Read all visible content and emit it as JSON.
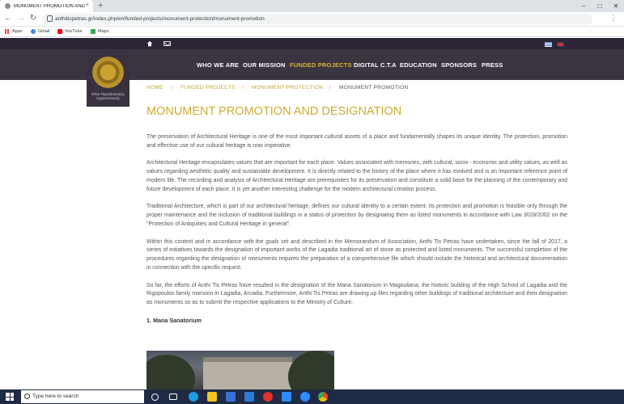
{
  "browser": {
    "tab_title": "MONUMENT PROMOTION AND",
    "tab_close": "×",
    "new_tab": "+",
    "url": "anthitispetras.gr/index.php/en/funded-projects/monument-protection/monument-promotion",
    "bookmarks": [
      "Apps",
      "Gmail",
      "YouTube",
      "Maps"
    ]
  },
  "site": {
    "logo_text": "Φίλοι Παραδοσιακής Αρχιτεκτονικής",
    "nav": [
      {
        "label": "WHO WE ARE"
      },
      {
        "label": "OUR MISSION"
      },
      {
        "label": "FUNDED PROJECTS"
      },
      {
        "label": "DIGITAL C.T.A"
      },
      {
        "label": "EDUCATION"
      },
      {
        "label": "SPONSORS"
      },
      {
        "label": "PRESS"
      }
    ],
    "breadcrumb": [
      "HOME",
      "FUNDED PROJECTS",
      "MONUMENT PROTECTION",
      "MONUMENT PROMOTION"
    ],
    "breadcrumb_sep": "/",
    "page_title": "MONUMENT PROMOTION AND DESIGNATION",
    "paragraphs": [
      "The preservation of Architectural Heritage is one of the most important cultural assets of a place and fundamentally shapes its unique identity. The protection, promotion and effective use of our cultural heritage is now imperative.",
      " Architectural Heritage encapsulates values that are important for each place. Values associated with memories, with cultural, socio - economic and utility values, as well as values regarding aesthetic quality and sustainable development. It is directly related to the history of the place where it has evolved and is an important reference point of modern life. The recording and analysis of Architectural Heritage are prerequisites for its preservation and constitute a solid base for the planning of the contemporary and future development of each place. It is yet another interesting challenge for the modern architectural creation process.",
      " Traditional Architecture, which is part of our architectural heritage, defines our cultural identity to a certain extent. Its protection and promotion is feasible only through the proper maintenance and the inclusion of traditional buildings in a status of protection by designating them as listed monuments in accordance with Law 3028/2002 on the \"Protection of Antiquities and Cultural Heritage in general\".",
      "Within this context and in accordance with the goals set and described in the Memorandum of Association, Anthi Tis Petras have undertaken, since the fall of 2017, a series of initiatives towards the designation of important works of the Lagadia traditional art of stone as protected and listed monuments. The successful completion of the procedures regarding the designation of monuments requires the preparation of a comprehensive file which should include the historical and architectural documentation in connection with the specific request.",
      " So far, the efforts of Anthi Tis Petras have resulted in the designation of the Mana Sanatorium in Magouliana, the historic building of the High School of Lagadia and the Rigopoulos family mansion in Lagadia, Arcadia. Furthermore, Anthi Tis Petras are drawing up files regarding other buildings of traditional architecture and their designation as monuments so as to submit the respective applications to the Ministry of Culture."
    ],
    "subheading": "1. Mana Sanatorium"
  },
  "taskbar": {
    "search_placeholder": "Type here to search"
  },
  "colors": {
    "accent": "#d1ac2f",
    "nav_bg": "#3c3441",
    "topbar_bg": "#2d2535",
    "taskbar_bg": "#1f2a44"
  }
}
